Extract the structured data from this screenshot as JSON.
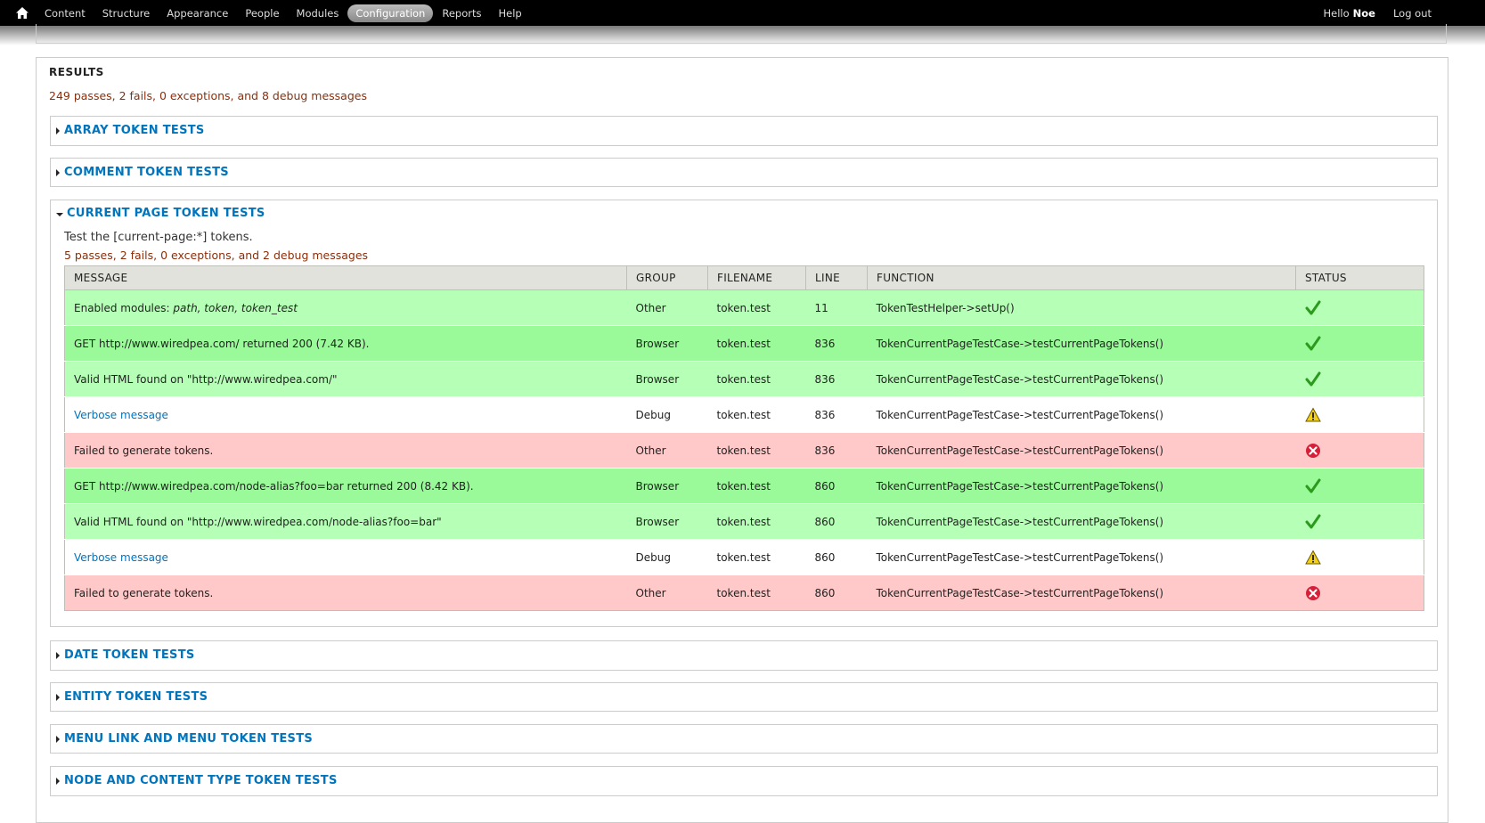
{
  "toolbar": {
    "menu": [
      "Content",
      "Structure",
      "Appearance",
      "People",
      "Modules",
      "Configuration",
      "Reports",
      "Help"
    ],
    "hello": "Hello",
    "username": "Noe",
    "logout": "Log out"
  },
  "results": {
    "title": "RESULTS",
    "summary": "249 passes, 2 fails, 0 exceptions, and 8 debug messages"
  },
  "groups": {
    "array": "ARRAY TOKEN TESTS",
    "comment": "COMMENT TOKEN TESTS",
    "current_page": {
      "title": "CURRENT PAGE TOKEN TESTS",
      "description": "Test the [current-page:*] tokens.",
      "summary": "5 passes, 2 fails, 0 exceptions, and 2 debug messages"
    },
    "date": "DATE TOKEN TESTS",
    "entity": "ENTITY TOKEN TESTS",
    "menu_link": "MENU LINK AND MENU TOKEN TESTS",
    "node": "NODE AND CONTENT TYPE TOKEN TESTS"
  },
  "table": {
    "headers": [
      "MESSAGE",
      "GROUP",
      "FILENAME",
      "LINE",
      "FUNCTION",
      "STATUS"
    ],
    "rows": [
      {
        "message_prefix": "Enabled modules: ",
        "message_em": "path, token, token_test",
        "group": "Other",
        "filename": "token.test",
        "line": "11",
        "function": "TokenTestHelper->setUp()",
        "status": "pass"
      },
      {
        "message": "GET http://www.wiredpea.com/ returned 200 (7.42 KB).",
        "group": "Browser",
        "filename": "token.test",
        "line": "836",
        "function": "TokenCurrentPageTestCase->testCurrentPageTokens()",
        "status": "pass"
      },
      {
        "message": "Valid HTML found on \"http://www.wiredpea.com/\"",
        "group": "Browser",
        "filename": "token.test",
        "line": "836",
        "function": "TokenCurrentPageTestCase->testCurrentPageTokens()",
        "status": "pass"
      },
      {
        "message": "Verbose message",
        "link": true,
        "group": "Debug",
        "filename": "token.test",
        "line": "836",
        "function": "TokenCurrentPageTestCase->testCurrentPageTokens()",
        "status": "debug"
      },
      {
        "message": "Failed to generate tokens.",
        "group": "Other",
        "filename": "token.test",
        "line": "836",
        "function": "TokenCurrentPageTestCase->testCurrentPageTokens()",
        "status": "fail"
      },
      {
        "message": "GET http://www.wiredpea.com/node-alias?foo=bar returned 200 (8.42 KB).",
        "group": "Browser",
        "filename": "token.test",
        "line": "860",
        "function": "TokenCurrentPageTestCase->testCurrentPageTokens()",
        "status": "pass"
      },
      {
        "message": "Valid HTML found on \"http://www.wiredpea.com/node-alias?foo=bar\"",
        "group": "Browser",
        "filename": "token.test",
        "line": "860",
        "function": "TokenCurrentPageTestCase->testCurrentPageTokens()",
        "status": "pass"
      },
      {
        "message": "Verbose message",
        "link": true,
        "group": "Debug",
        "filename": "token.test",
        "line": "860",
        "function": "TokenCurrentPageTestCase->testCurrentPageTokens()",
        "status": "debug"
      },
      {
        "message": "Failed to generate tokens.",
        "group": "Other",
        "filename": "token.test",
        "line": "860",
        "function": "TokenCurrentPageTestCase->testCurrentPageTokens()",
        "status": "fail"
      }
    ]
  },
  "icons": {
    "pass": "check-icon",
    "debug": "warning-icon",
    "fail": "error-icon"
  },
  "colors": {
    "link": "#0074bd",
    "summary": "#8c2e0b",
    "pass_row": "#b6ffb6",
    "pass_row_alt": "#9afa9a",
    "fail_row": "#ffc9c9"
  }
}
